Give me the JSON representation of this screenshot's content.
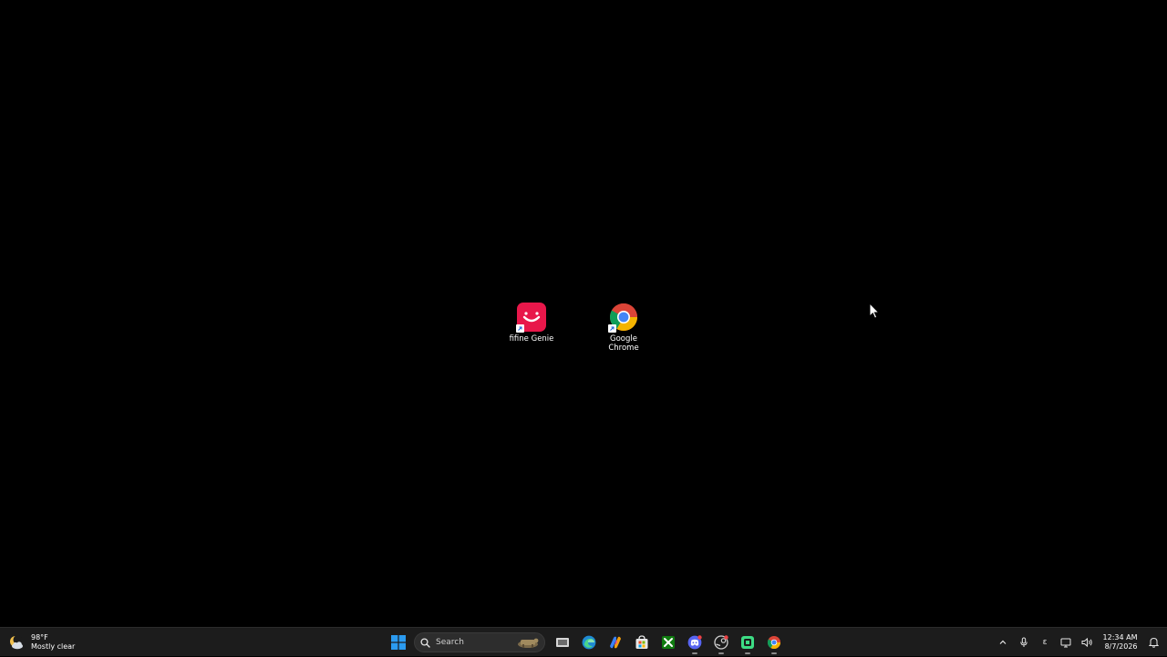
{
  "desktop": {
    "icons": [
      {
        "label": "fifine Genie",
        "icon": "fifine-genie-icon",
        "color": "#e8174a"
      },
      {
        "label": "Google\nChrome",
        "icon": "chrome-icon"
      }
    ]
  },
  "taskbar": {
    "weather": {
      "temp": "98°F",
      "condition": "Mostly clear",
      "icon": "moon-cloud-icon"
    },
    "search": {
      "label": "Search"
    },
    "pinned": [
      {
        "name": "task-view",
        "icon": "task-view-icon"
      },
      {
        "name": "edge",
        "icon": "edge-icon"
      },
      {
        "name": "copilot",
        "icon": "copilot-icon"
      },
      {
        "name": "microsoft-store",
        "icon": "store-icon"
      },
      {
        "name": "xbox",
        "icon": "xbox-icon"
      },
      {
        "name": "discord",
        "icon": "discord-icon"
      },
      {
        "name": "steam",
        "icon": "steam-icon"
      },
      {
        "name": "app-green",
        "icon": "green-app-icon"
      },
      {
        "name": "chrome",
        "icon": "chrome-icon"
      }
    ],
    "tray": {
      "language": "ε",
      "time": "12:34 AM",
      "date": "8/7/2026"
    }
  },
  "colors": {
    "desktop_bg": "#000000",
    "taskbar_bg": "#1c1c1c",
    "start_blue": "#2b9bf0"
  }
}
